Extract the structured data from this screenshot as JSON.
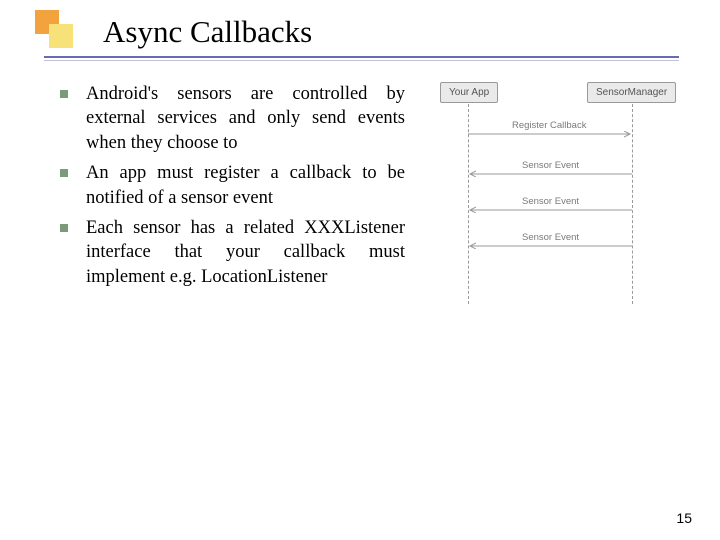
{
  "title": "Async Callbacks",
  "bullets": [
    "Android's sensors are controlled by external services and only send events when they choose to",
    "An app must register a callback to be notified of a sensor event",
    "Each sensor has a related XXXListener interface that your callback must implement e.g. LocationListener"
  ],
  "diagram": {
    "left_box": "Your App",
    "right_box": "SensorManager",
    "messages": [
      "Register Callback",
      "Sensor Event",
      "Sensor Event",
      "Sensor Event"
    ]
  },
  "page_number": "15"
}
